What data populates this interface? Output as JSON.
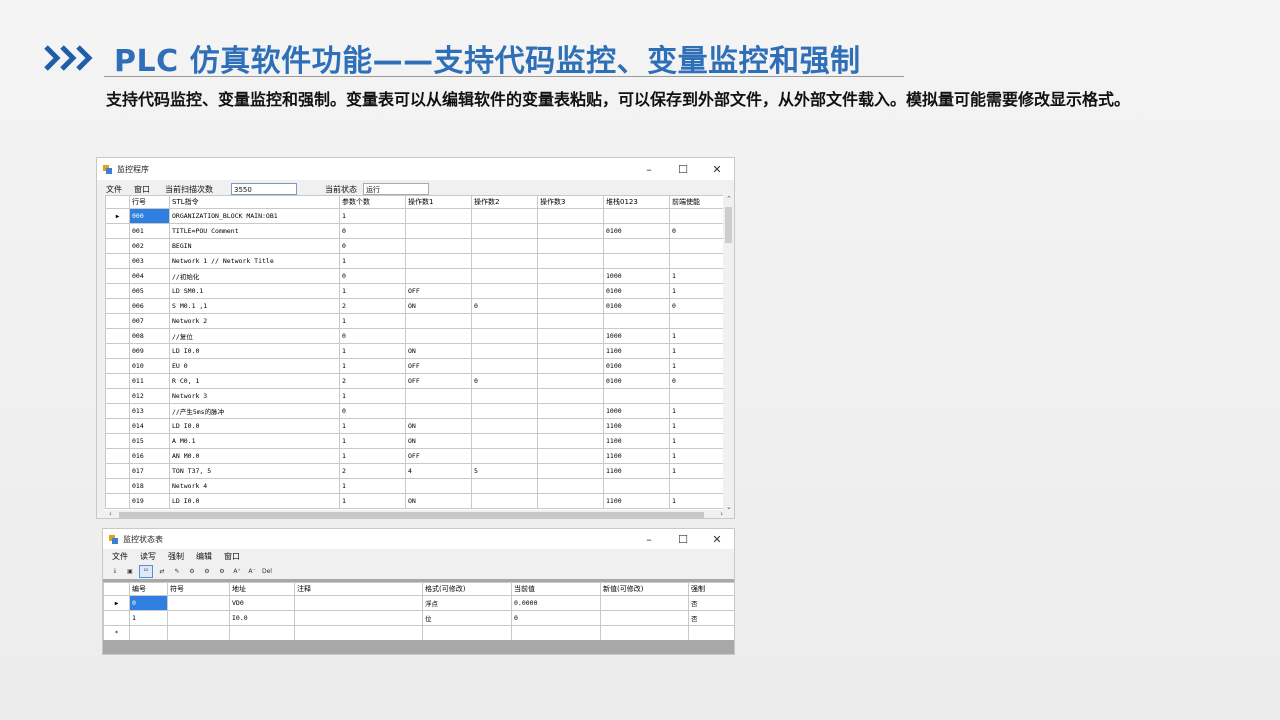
{
  "slide": {
    "title": "PLC 仿真软件功能——支持代码监控、变量监控和强制",
    "description": "支持代码监控、变量监控和强制。变量表可以从编辑软件的变量表粘贴，可以保存到外部文件，从外部文件载入。模拟量可能需要修改显示格式。",
    "accent_color": "#2e6fb8"
  },
  "monitor_window": {
    "title": "监控程序",
    "controls": {
      "minimize": "–",
      "maximize": "☐",
      "close": "✕"
    },
    "menu": [
      "文件",
      "窗口"
    ],
    "scan_count_label": "当前扫描次数",
    "scan_count_value": "3550",
    "state_label": "当前状态",
    "state_value": "运行",
    "columns": [
      "行号",
      "STL指令",
      "参数个数",
      "操作数1",
      "操作数2",
      "操作数3",
      "堆栈0123",
      "前端使能"
    ],
    "rows": [
      [
        "000",
        "ORGANIZATION_BLOCK MAIN:OB1",
        "1",
        "",
        "",
        "",
        "",
        ""
      ],
      [
        "001",
        "TITLE=POU Comment",
        "0",
        "",
        "",
        "",
        "0100",
        "0"
      ],
      [
        "002",
        "BEGIN",
        "0",
        "",
        "",
        "",
        "",
        ""
      ],
      [
        "003",
        "Network 1 // Network Title",
        "1",
        "",
        "",
        "",
        "",
        ""
      ],
      [
        "004",
        "//初始化",
        "0",
        "",
        "",
        "",
        "1000",
        "1"
      ],
      [
        "005",
        "LD     SM0.1",
        "1",
        "OFF",
        "",
        "",
        "0100",
        "1"
      ],
      [
        "006",
        "S      M0.1 ,1",
        "2",
        "ON",
        "0",
        "",
        "0100",
        "0"
      ],
      [
        "007",
        "Network 2",
        "1",
        "",
        "",
        "",
        "",
        ""
      ],
      [
        "008",
        "//复位",
        "0",
        "",
        "",
        "",
        "1000",
        "1"
      ],
      [
        "009",
        "LD     I0.0",
        "1",
        "ON",
        "",
        "",
        "1100",
        "1"
      ],
      [
        "010",
        "EU 0",
        "1",
        "OFF",
        "",
        "",
        "0100",
        "1"
      ],
      [
        "011",
        "R      C0, 1",
        "2",
        "OFF",
        "0",
        "",
        "0100",
        "0"
      ],
      [
        "012",
        "Network 3",
        "1",
        "",
        "",
        "",
        "",
        ""
      ],
      [
        "013",
        "//产生5ms的脉冲",
        "0",
        "",
        "",
        "",
        "1000",
        "1"
      ],
      [
        "014",
        "LD     I0.0",
        "1",
        "ON",
        "",
        "",
        "1100",
        "1"
      ],
      [
        "015",
        "A      M0.1",
        "1",
        "ON",
        "",
        "",
        "1100",
        "1"
      ],
      [
        "016",
        "AN     M0.0",
        "1",
        "OFF",
        "",
        "",
        "1100",
        "1"
      ],
      [
        "017",
        "TON    T37, 5",
        "2",
        "4",
        "5",
        "",
        "1100",
        "1"
      ],
      [
        "018",
        "Network 4",
        "1",
        "",
        "",
        "",
        "",
        ""
      ],
      [
        "019",
        "LD     I0.0",
        "1",
        "ON",
        "",
        "",
        "1100",
        "1"
      ]
    ]
  },
  "status_window": {
    "title": "监控状态表",
    "controls": {
      "minimize": "–",
      "maximize": "☐",
      "close": "✕"
    },
    "menu": [
      "文件",
      "读写",
      "强制",
      "编辑",
      "窗口"
    ],
    "toolbar": [
      {
        "icon": "download-icon",
        "glyph": "⤓"
      },
      {
        "icon": "save-icon",
        "glyph": "▣"
      },
      {
        "icon": "read-icon",
        "glyph": "¹⁰"
      },
      {
        "icon": "write-icon",
        "glyph": "⇄"
      },
      {
        "icon": "pencil-icon",
        "glyph": "✎"
      },
      {
        "icon": "force-icon",
        "glyph": "⚙"
      },
      {
        "icon": "unforce-icon",
        "glyph": "⚙"
      },
      {
        "icon": "unforce-all-icon",
        "glyph": "⚙"
      },
      {
        "icon": "font-increase-icon",
        "glyph": "A⁺"
      },
      {
        "icon": "font-decrease-icon",
        "glyph": "A⁻"
      },
      {
        "icon": "delete-icon",
        "glyph": "Del"
      }
    ],
    "columns": [
      "编号",
      "符号",
      "地址",
      "注释",
      "格式(可修改)",
      "当前值",
      "新值(可修改)",
      "强制"
    ],
    "rows": [
      [
        "0",
        "",
        "VD0",
        "",
        "浮点",
        "0.0000",
        "",
        "否"
      ],
      [
        "1",
        "",
        "I0.0",
        "",
        "位",
        "0",
        "",
        "否"
      ]
    ],
    "new_row_marker": "*",
    "current_row_marker": "▶"
  }
}
